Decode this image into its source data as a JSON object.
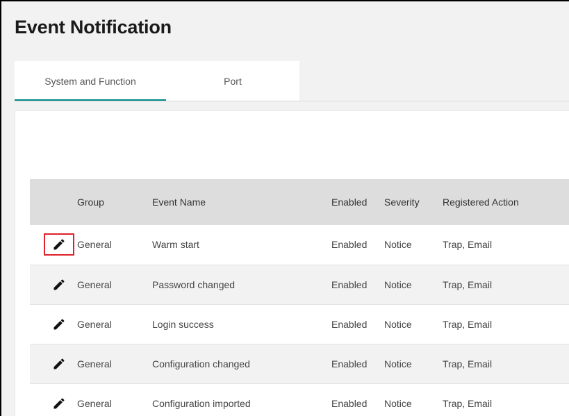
{
  "page": {
    "title": "Event Notification"
  },
  "tabs": [
    {
      "label": "System and Function",
      "active": true
    },
    {
      "label": "Port",
      "active": false
    }
  ],
  "table": {
    "headers": {
      "edit": "",
      "group": "Group",
      "event_name": "Event Name",
      "enabled": "Enabled",
      "severity": "Severity",
      "registered_action": "Registered Action"
    },
    "rows": [
      {
        "group": "General",
        "event_name": "Warm start",
        "enabled": "Enabled",
        "severity": "Notice",
        "registered_action": "Trap, Email",
        "highlighted": true
      },
      {
        "group": "General",
        "event_name": "Password changed",
        "enabled": "Enabled",
        "severity": "Notice",
        "registered_action": "Trap, Email"
      },
      {
        "group": "General",
        "event_name": "Login success",
        "enabled": "Enabled",
        "severity": "Notice",
        "registered_action": "Trap, Email"
      },
      {
        "group": "General",
        "event_name": "Configuration changed",
        "enabled": "Enabled",
        "severity": "Notice",
        "registered_action": "Trap, Email"
      },
      {
        "group": "General",
        "event_name": "Configuration imported",
        "enabled": "Enabled",
        "severity": "Notice",
        "registered_action": "Trap, Email"
      }
    ]
  },
  "icons": {
    "edit": "pencil-icon"
  },
  "colors": {
    "accent": "#008787",
    "highlight": "#e0202a",
    "header_bg": "#dddddd",
    "stripe": "#f2f2f2"
  }
}
